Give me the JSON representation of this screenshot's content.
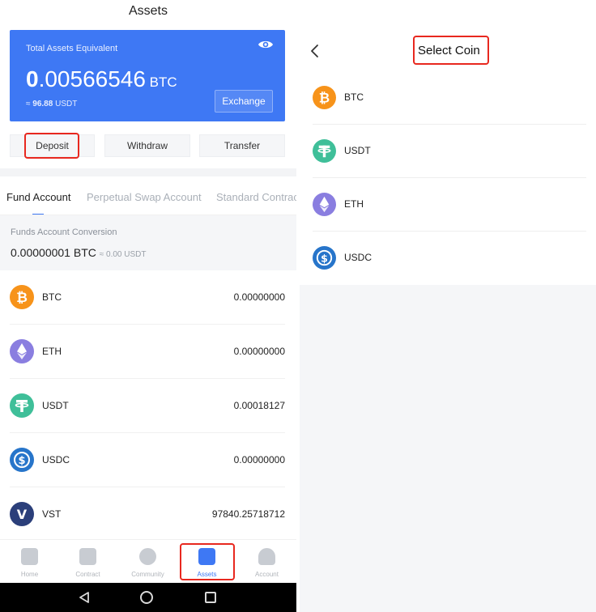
{
  "left": {
    "title": "Assets",
    "card": {
      "label": "Total Assets Equivalent",
      "balance_int": "0",
      "balance_dec": ".00566546",
      "balance_unit": "BTC",
      "approx_prefix": "≈",
      "approx_value": "96.88",
      "approx_unit": "USDT",
      "exchange_label": "Exchange"
    },
    "actions": {
      "deposit": "Deposit",
      "withdraw": "Withdraw",
      "transfer": "Transfer"
    },
    "tabs": [
      "Fund Account",
      "Perpetual Swap Account",
      "Standard Contract"
    ],
    "conversion": {
      "label": "Funds Account Conversion",
      "value": "0.00000001 BTC",
      "approx": "≈ 0.00 USDT"
    },
    "coins": [
      {
        "symbol": "BTC",
        "amount": "0.00000000",
        "color": "#f7931a"
      },
      {
        "symbol": "ETH",
        "amount": "0.00000000",
        "color": "#8a7ee0"
      },
      {
        "symbol": "USDT",
        "amount": "0.00018127",
        "color": "#3fbf99"
      },
      {
        "symbol": "USDC",
        "amount": "0.00000000",
        "color": "#2775ca"
      },
      {
        "symbol": "VST",
        "amount": "97840.25718712",
        "color": "#2b3f7a"
      }
    ],
    "tabbar": [
      {
        "label": "Home",
        "icon": "home-icon"
      },
      {
        "label": "Contract",
        "icon": "contract-icon"
      },
      {
        "label": "Community",
        "icon": "community-icon"
      },
      {
        "label": "Assets",
        "icon": "wallet-icon"
      },
      {
        "label": "Account",
        "icon": "user-icon"
      }
    ]
  },
  "right": {
    "title": "Select Coin",
    "coins": [
      {
        "symbol": "BTC",
        "color": "#f7931a"
      },
      {
        "symbol": "USDT",
        "color": "#3fbf99"
      },
      {
        "symbol": "ETH",
        "color": "#8a7ee0"
      },
      {
        "symbol": "USDC",
        "color": "#2775ca"
      }
    ]
  },
  "colors": {
    "accent": "#3e78f4",
    "highlight": "#e8281f"
  }
}
